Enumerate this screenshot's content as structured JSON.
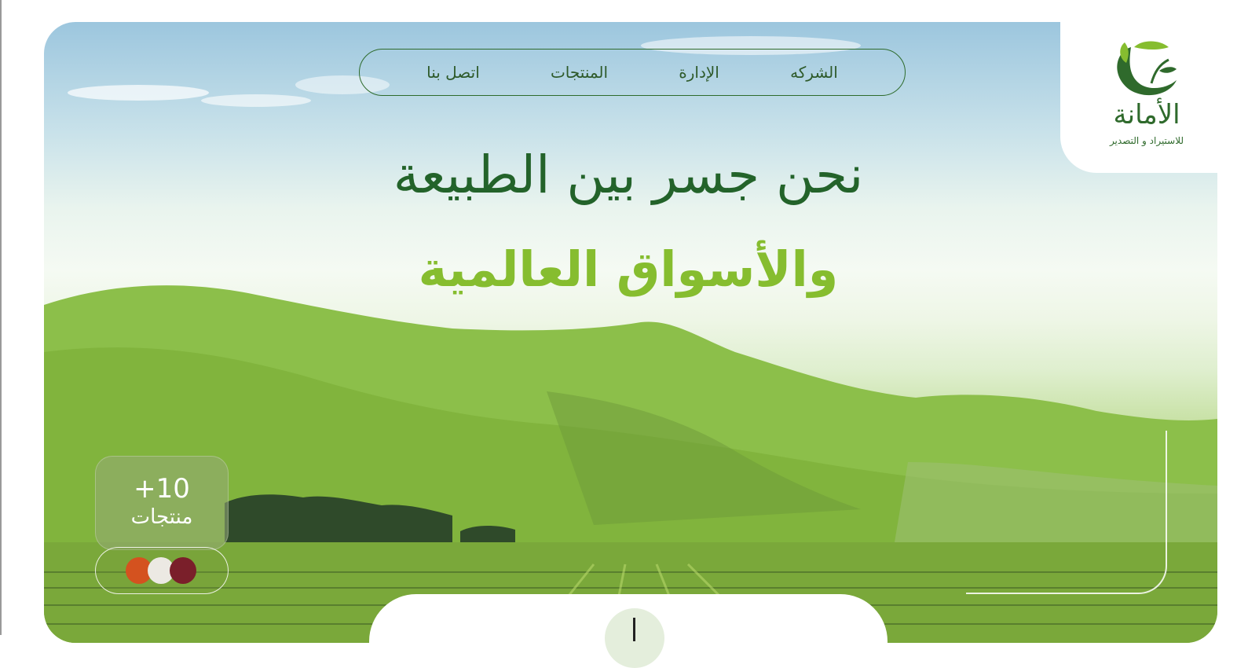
{
  "brand": {
    "name": "الأمانة",
    "tagline": "للاستيراد و التصدير",
    "colors": {
      "primary_dark": "#23632a",
      "primary_light": "#86bd2f"
    }
  },
  "nav": {
    "items": [
      {
        "label": "الشركه"
      },
      {
        "label": "الإدارة"
      },
      {
        "label": "المنتجات"
      },
      {
        "label": "اتصل بنا"
      }
    ]
  },
  "hero": {
    "headline_line1": "نحن جسر بين الطبيعة",
    "headline_line2": "والأسواق العالمية",
    "stat": {
      "value": "+10",
      "label": "منتجات"
    },
    "swatches": [
      {
        "name": "red-spice-swatch",
        "color": "#d4521f"
      },
      {
        "name": "white-grain-swatch",
        "color": "#e9e6e0"
      },
      {
        "name": "dark-red-bean-swatch",
        "color": "#7a1f2a"
      }
    ]
  },
  "icons": {
    "logo": "leaf-sprout-logo-icon",
    "scroll": "scroll-down-icon"
  }
}
